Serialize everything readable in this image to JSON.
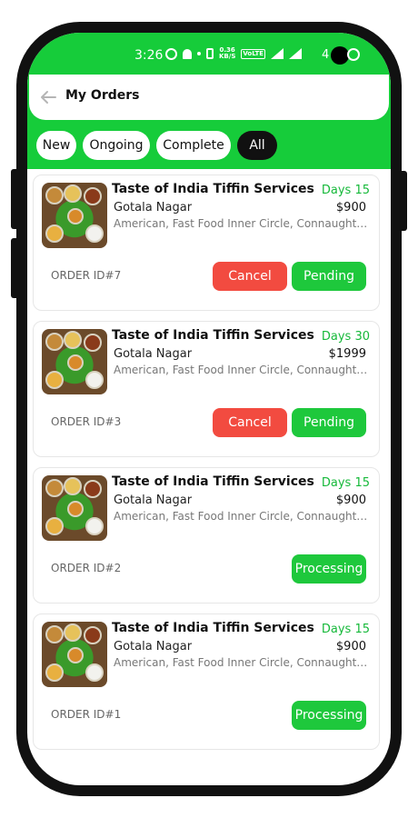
{
  "status_bar": {
    "time": "3:26",
    "speed": "0.36\nKB/S",
    "volte": "VoLTE",
    "battery": "4"
  },
  "header": {
    "back_icon": "back-arrow-icon",
    "title": "My Orders"
  },
  "tabs": [
    {
      "label": "New",
      "active": false
    },
    {
      "label": "Ongoing",
      "active": false
    },
    {
      "label": "Complete",
      "active": false
    },
    {
      "label": "All",
      "active": true
    }
  ],
  "orders": [
    {
      "restaurant": "Taste of India Tiffin Services",
      "days": "Days 15",
      "area": "Gotala Nagar",
      "price": "$900",
      "cuisine": "American, Fast Food Inner Circle, Connaught Pl...",
      "order_id": "ORDER ID#7",
      "cancel_label": "Cancel",
      "status_label": "Pending"
    },
    {
      "restaurant": "Taste of India Tiffin Services",
      "days": "Days 30",
      "area": "Gotala Nagar",
      "price": "$1999",
      "cuisine": "American, Fast Food Inner Circle, Connaught Pl...",
      "order_id": "ORDER ID#3",
      "cancel_label": "Cancel",
      "status_label": "Pending"
    },
    {
      "restaurant": "Taste of India Tiffin Services",
      "days": "Days 15",
      "area": "Gotala Nagar",
      "price": "$900",
      "cuisine": "American, Fast Food Inner Circle, Connaught Pl...",
      "order_id": "ORDER ID#2",
      "status_label": "Processing"
    },
    {
      "restaurant": "Taste of India Tiffin Services",
      "days": "Days 15",
      "area": "Gotala Nagar",
      "price": "$900",
      "cuisine": "American, Fast Food Inner Circle, Connaught Pl...",
      "order_id": "ORDER ID#1",
      "status_label": "Processing"
    }
  ],
  "colors": {
    "brand_green": "#16cc3a",
    "cancel_red": "#f24b40",
    "days_green": "#16b93a"
  }
}
